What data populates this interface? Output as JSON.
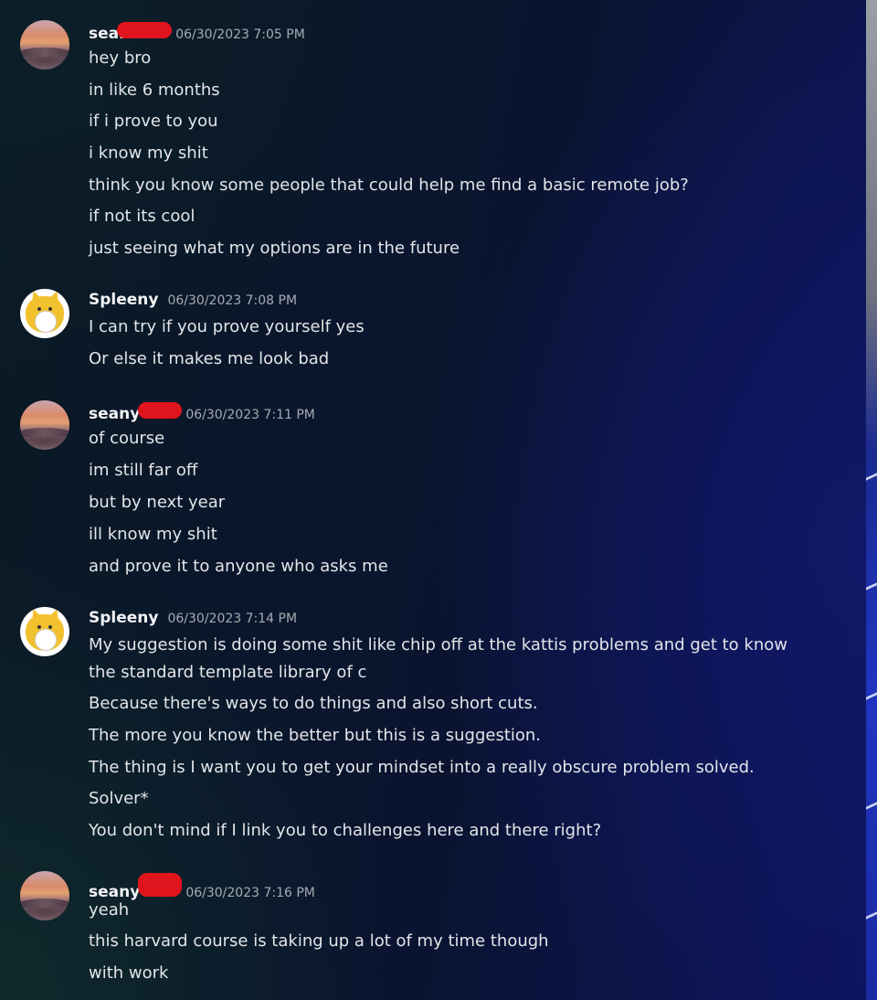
{
  "groups": [
    {
      "user": {
        "name": "sean",
        "avatar": "sunset-landscape-avatar",
        "redacted": true
      },
      "timestamp": "06/30/2023 7:05 PM",
      "messages": [
        "hey bro",
        "in like 6 months",
        "if i prove to you",
        "i know my shit",
        "think you know some people that could help me find a basic remote job?",
        "if not its cool",
        "just seeing what my options are in the future"
      ]
    },
    {
      "user": {
        "name": "Spleeny",
        "avatar": "yellow-cat-avatar",
        "redacted": false
      },
      "timestamp": "06/30/2023 7:08 PM",
      "messages": [
        "I can try if you prove yourself yes",
        "Or else it makes me look bad"
      ]
    },
    {
      "user": {
        "name": "seany",
        "avatar": "sunset-landscape-avatar",
        "redacted": true
      },
      "timestamp": "06/30/2023 7:11 PM",
      "messages": [
        "of course",
        "im still far off",
        "but by next year",
        "ill know my shit",
        "and prove it to anyone who asks me"
      ]
    },
    {
      "user": {
        "name": "Spleeny",
        "avatar": "yellow-cat-avatar",
        "redacted": false
      },
      "timestamp": "06/30/2023 7:14 PM",
      "messages": [
        "My suggestion is doing some shit like  chip off at the kattis problems and get to know the standard template library of c",
        "Because there's ways to do things and also short cuts.",
        "The more you know the better but this is a suggestion.",
        "The thing is I want you to get your mindset into a really obscure problem solved.",
        "Solver*",
        "You don't mind if I link you to challenges here and there right?"
      ]
    },
    {
      "user": {
        "name": "seany",
        "avatar": "sunset-landscape-avatar",
        "redacted": true
      },
      "timestamp": "06/30/2023 7:16 PM",
      "messages": [
        "yeah",
        "this harvard course is taking up a lot of my time though",
        "with work"
      ]
    }
  ],
  "colors": {
    "redaction": "#e0141c",
    "username": "#f2f3f5",
    "timestamp": "#a7abb3",
    "message_text": "#e3e5e8"
  }
}
